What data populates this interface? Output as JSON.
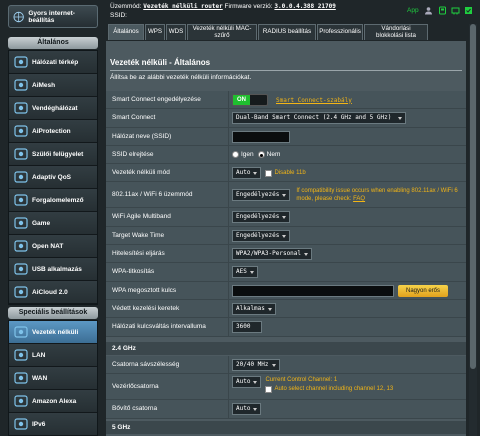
{
  "sidebar": {
    "quick_internet": "Gyors internet-beállítás",
    "general_header": "Általános",
    "general_items": [
      {
        "label": "Hálózati térkép",
        "icon": "network-map-icon"
      },
      {
        "label": "AiMesh",
        "icon": "aimesh-icon"
      },
      {
        "label": "Vendéghálózat",
        "icon": "guest-network-icon"
      },
      {
        "label": "AiProtection",
        "icon": "aiprotection-icon"
      },
      {
        "label": "Szülői felügyelet",
        "icon": "parental-control-icon"
      },
      {
        "label": "Adaptív QoS",
        "icon": "adaptive-qos-icon"
      },
      {
        "label": "Forgalomelemző",
        "icon": "traffic-analyzer-icon"
      },
      {
        "label": "Game",
        "icon": "game-icon"
      },
      {
        "label": "Open NAT",
        "icon": "open-nat-icon"
      },
      {
        "label": "USB alkalmazás",
        "icon": "usb-icon"
      },
      {
        "label": "AiCloud 2.0",
        "icon": "aicloud-icon"
      }
    ],
    "advanced_header": "Speciális beállítások",
    "advanced_items": [
      {
        "label": "Vezeték nélküli",
        "icon": "wireless-icon",
        "active": true
      },
      {
        "label": "LAN",
        "icon": "lan-icon"
      },
      {
        "label": "WAN",
        "icon": "wan-icon"
      },
      {
        "label": "Amazon Alexa",
        "icon": "alexa-icon"
      },
      {
        "label": "IPv6",
        "icon": "ipv6-icon"
      }
    ]
  },
  "topbar": {
    "mode_label": "Üzemmód:",
    "mode_value": "Vezeték nélküli router",
    "fw_label": "Firmware verzió:",
    "fw_value": "3.0.0.4.388_21709",
    "ssid_label": "SSID:",
    "app_label": "App"
  },
  "tabs": [
    "Általános",
    "WPS",
    "WDS",
    "Vezeték nélküli MAC-szűrő",
    "RADIUS beállítás",
    "Professzionális",
    "Vándorlási blokkolási lista"
  ],
  "page": {
    "title": "Vezeték nélküli - Általános",
    "desc": "Állítsa be az alábbi vezeték nélküli információkat."
  },
  "form": {
    "smart_connect_label": "Smart Connect engedélyezése",
    "smart_connect_toggle": "ON",
    "smart_connect_rule": "Smart Connect-szabály",
    "smart_connect2_label": "Smart Connect",
    "smart_connect2_value": "Dual-Band Smart Connect (2.4 GHz and 5 GHz)",
    "ssid_label": "Hálózat neve (SSID)",
    "ssid_hidden_label": "SSID elrejtése",
    "ssid_hidden_yes": "Igen",
    "ssid_hidden_no": "Nem",
    "wireless_mode_label": "Vezeték nélküli mód",
    "wireless_mode_value": "Auto",
    "disable_11b": "Disable 11b",
    "ax_label": "802.11ax / WiFi 6 üzemmód",
    "ax_value": "Engedélyezés",
    "ax_note": "If compatibility issue occurs when enabling 802.11ax / WiFi 6 mode, please check:",
    "ax_faq": "FAQ",
    "agile_label": "WiFi Agile Multiband",
    "agile_value": "Engedélyezés",
    "twt_label": "Target Wake Time",
    "twt_value": "Engedélyezés",
    "auth_label": "Hitelesítési eljárás",
    "auth_value": "WPA2/WPA3-Personal",
    "enc_label": "WPA-titkosítás",
    "enc_value": "AES",
    "psk_label": "WPA megosztott kulcs",
    "psk_strength": "Nagyon erős",
    "pmf_label": "Védett kezelési keretek",
    "pmf_value": "Alkalmas",
    "gtk_label": "Hálózati kulcsváltás intervalluma",
    "gtk_value": "3600"
  },
  "band24": {
    "header": "2.4 GHz",
    "bw_label": "Csatorna sávszélesség",
    "bw_value": "20/40 MHz",
    "ch_label": "Vezérlőcsatorna",
    "ch_value": "Auto",
    "ch_current": "Current Control Channel: 1",
    "ch_auto_note": "Auto select channel including channel 12, 13",
    "ext_label": "Bővítő csatorna",
    "ext_value": "Auto"
  },
  "band5": {
    "header": "5 GHz"
  },
  "colors": {
    "accent": "#f2b516",
    "active_nav": "#4a84b0",
    "on_green": "#1fcf3f"
  }
}
